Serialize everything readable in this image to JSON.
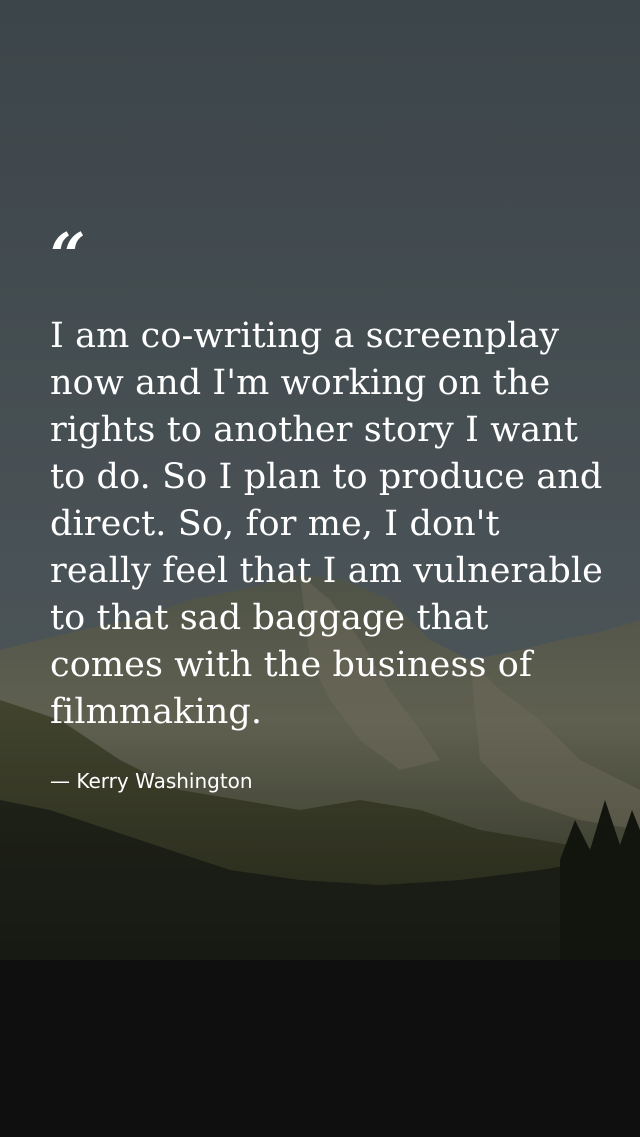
{
  "background": {
    "description_icon": "mountain-landscape",
    "sky_color": "#4a5558",
    "mountain_color": "#6b6f5e",
    "forest_color": "#1a1d16"
  },
  "quote": {
    "mark": "“",
    "text": "I am co-writing a screenplay now and I'm working on the rights to another story I want to do. So I plan to produce and direct. So, for me, I don't really feel that I am vulnerable to that sad baggage that comes with the business of filmmaking.",
    "author": "— Kerry Washington"
  }
}
